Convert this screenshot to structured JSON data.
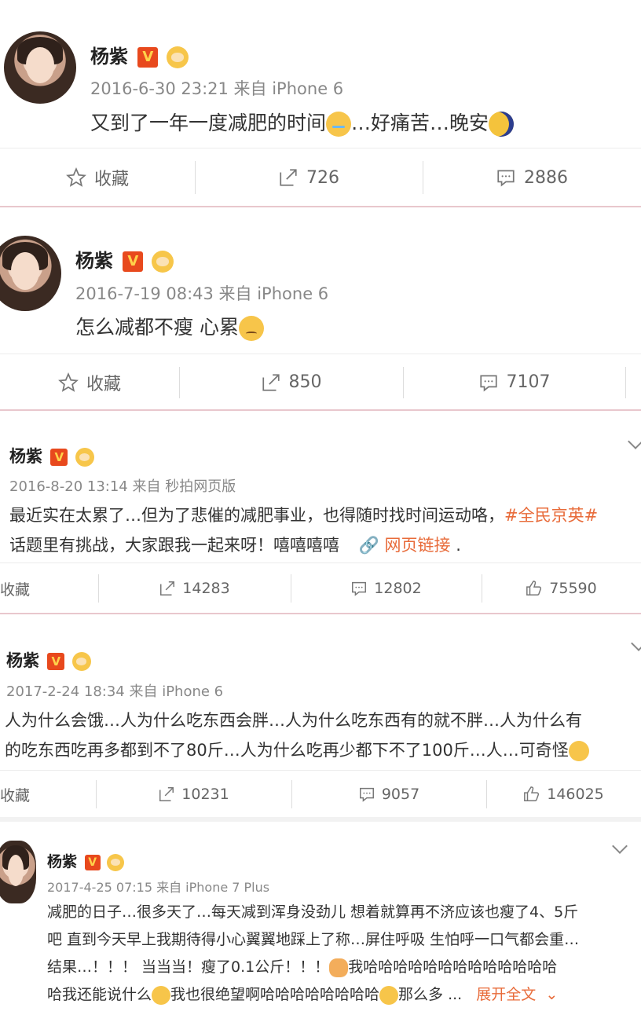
{
  "posts": [
    {
      "name": "杨紫",
      "badge": "V",
      "meta": "2016-6-30 23:21 来自 iPhone 6",
      "text_a": "又到了一年一度减肥的时间",
      "text_b": "…好痛苦…晚安",
      "actions": {
        "fav": "收藏",
        "repost": "726",
        "comment": "2886"
      }
    },
    {
      "name": "杨紫",
      "badge": "V",
      "meta": "2016-7-19 08:43 来自 iPhone 6",
      "text_a": "怎么减都不瘦 心累",
      "actions": {
        "fav": "收藏",
        "repost": "850",
        "comment": "7107"
      }
    },
    {
      "name": "杨紫",
      "badge": "V",
      "meta": "2016-8-20 13:14 来自 秒拍网页版",
      "text_a": "最近实在太累了…但为了悲催的减肥事业，也得随时找时间运动咯，",
      "hashtag": "#全民京英#",
      "text_b": "话题里有挑战，大家跟我一起来呀！嘻嘻嘻嘻",
      "link": "网页链接",
      "text_c": ".",
      "actions": {
        "fav": "收藏",
        "repost": "14283",
        "comment": "12802",
        "like": "75590"
      }
    },
    {
      "name": "杨紫",
      "badge": "V",
      "meta": "2017-2-24 18:34 来自 iPhone 6",
      "text_a": "人为什么会饿…人为什么吃东西会胖…人为什么吃东西有的就不胖…人为什么有",
      "text_b": "的吃东西吃再多都到不了80斤…人为什么吃再少都下不了100斤…人…可奇怪",
      "actions": {
        "fav": "收藏",
        "repost": "10231",
        "comment": "9057",
        "like": "146025"
      }
    },
    {
      "name": "杨紫",
      "badge": "V",
      "meta": "2017-4-25 07:15 来自 iPhone 7 Plus",
      "line1": "减肥的日子…很多天了…每天减到浑身没劲儿 想着就算再不济应该也瘦了4、5斤",
      "line2": "吧 直到今天早上我期待得小心翼翼地踩上了称…屏住呼吸 生怕呼一口气都会重…",
      "line3_a": "结果…！！！ 当当当！瘦了0.1公斤！！！",
      "line3_b": "我哈哈哈哈哈哈哈哈哈哈哈哈哈",
      "line4_a": "哈我还能说什么",
      "line4_b": "我也很绝望啊哈哈哈哈哈哈哈哈",
      "line4_c": "那么多 ...",
      "expand": "展开全文"
    }
  ],
  "colors": {
    "accent": "#e86b3a",
    "badge": "#e8491d",
    "separator": "#e9c7cd"
  }
}
